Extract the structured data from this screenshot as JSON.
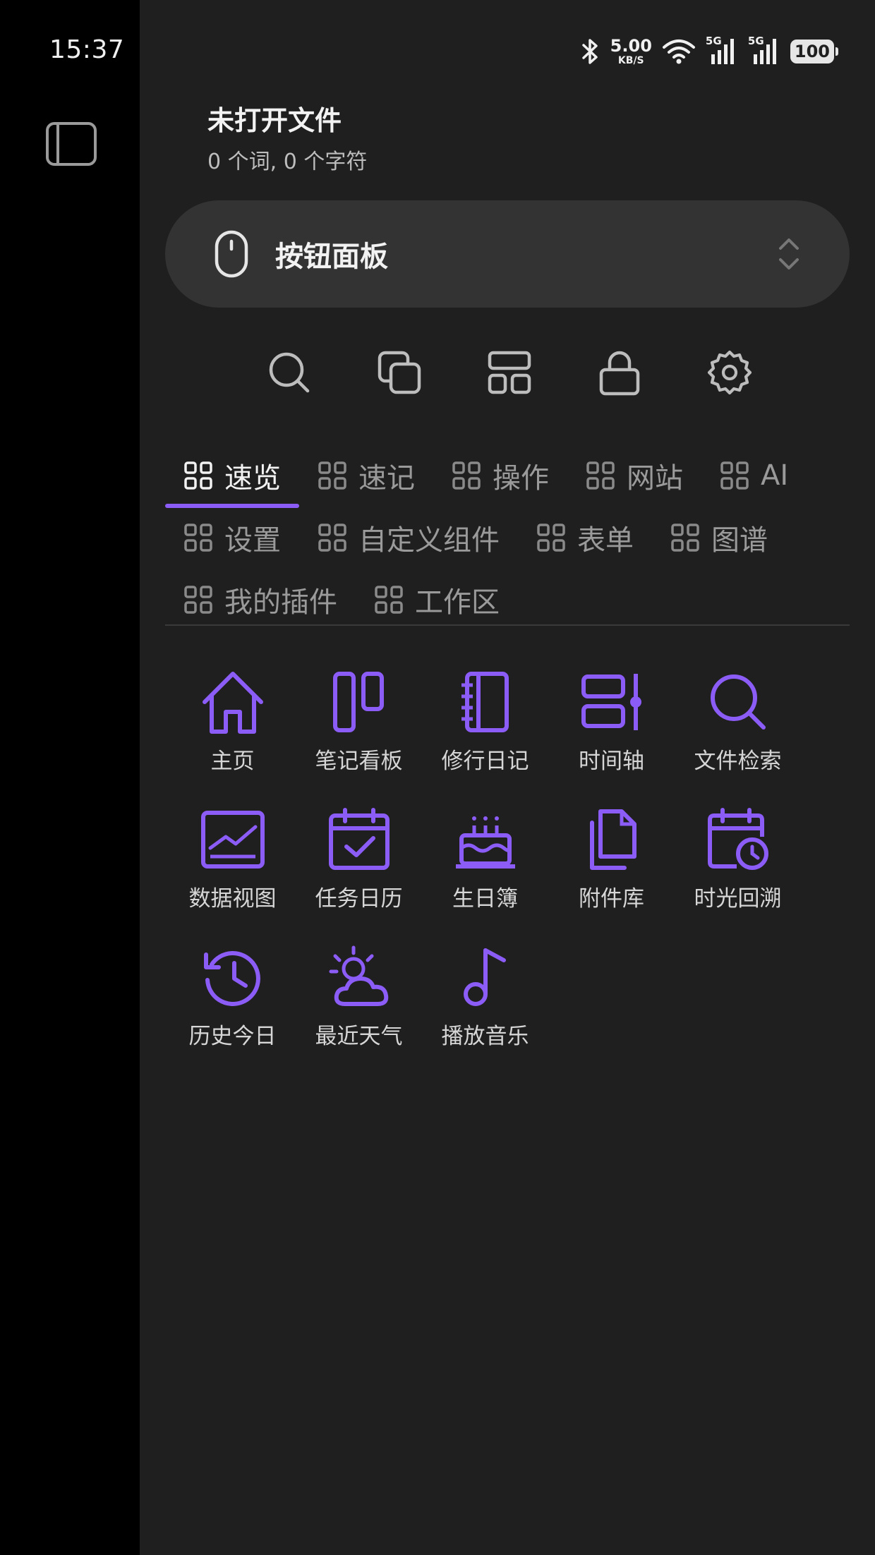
{
  "status_bar": {
    "time": "15:37",
    "net_speed_value": "5.00",
    "net_speed_unit": "KB/S",
    "signal_1_label": "5G",
    "signal_2_label": "5G",
    "battery": "100",
    "icons": [
      "bluetooth-icon",
      "wifi-icon",
      "cellular-signal-icon",
      "cellular-signal-icon"
    ]
  },
  "file_info": {
    "title": "未打开文件",
    "stats": "0 个词, 0 个字符"
  },
  "panel_selector": {
    "label": "按钮面板",
    "icon": "mouse-icon"
  },
  "toolbar": {
    "buttons": [
      "search-icon",
      "copy-icon",
      "layout-icon",
      "lock-icon",
      "gear-icon"
    ]
  },
  "tabs": [
    {
      "label": "速览",
      "active": true
    },
    {
      "label": "速记",
      "active": false
    },
    {
      "label": "操作",
      "active": false
    },
    {
      "label": "网站",
      "active": false
    },
    {
      "label": "AI",
      "active": false
    },
    {
      "label": "设置",
      "active": false
    },
    {
      "label": "自定义组件",
      "active": false
    },
    {
      "label": "表单",
      "active": false
    },
    {
      "label": "图谱",
      "active": false
    },
    {
      "label": "我的插件",
      "active": false
    },
    {
      "label": "工作区",
      "active": false
    }
  ],
  "items": [
    {
      "label": "主页",
      "icon": "home-icon"
    },
    {
      "label": "笔记看板",
      "icon": "kanban-icon"
    },
    {
      "label": "修行日记",
      "icon": "notebook-icon"
    },
    {
      "label": "时间轴",
      "icon": "timeline-icon"
    },
    {
      "label": "文件检索",
      "icon": "search-icon"
    },
    {
      "label": "数据视图",
      "icon": "chart-icon"
    },
    {
      "label": "任务日历",
      "icon": "calendar-check-icon"
    },
    {
      "label": "生日簿",
      "icon": "cake-icon"
    },
    {
      "label": "附件库",
      "icon": "files-icon"
    },
    {
      "label": "时光回溯",
      "icon": "calendar-clock-icon"
    },
    {
      "label": "历史今日",
      "icon": "history-icon"
    },
    {
      "label": "最近天气",
      "icon": "weather-icon"
    },
    {
      "label": "播放音乐",
      "icon": "music-note-icon"
    }
  ],
  "colors": {
    "accent": "#8b5cf6",
    "panel_bg": "#1f1f1f",
    "selector_bg": "#333333"
  }
}
